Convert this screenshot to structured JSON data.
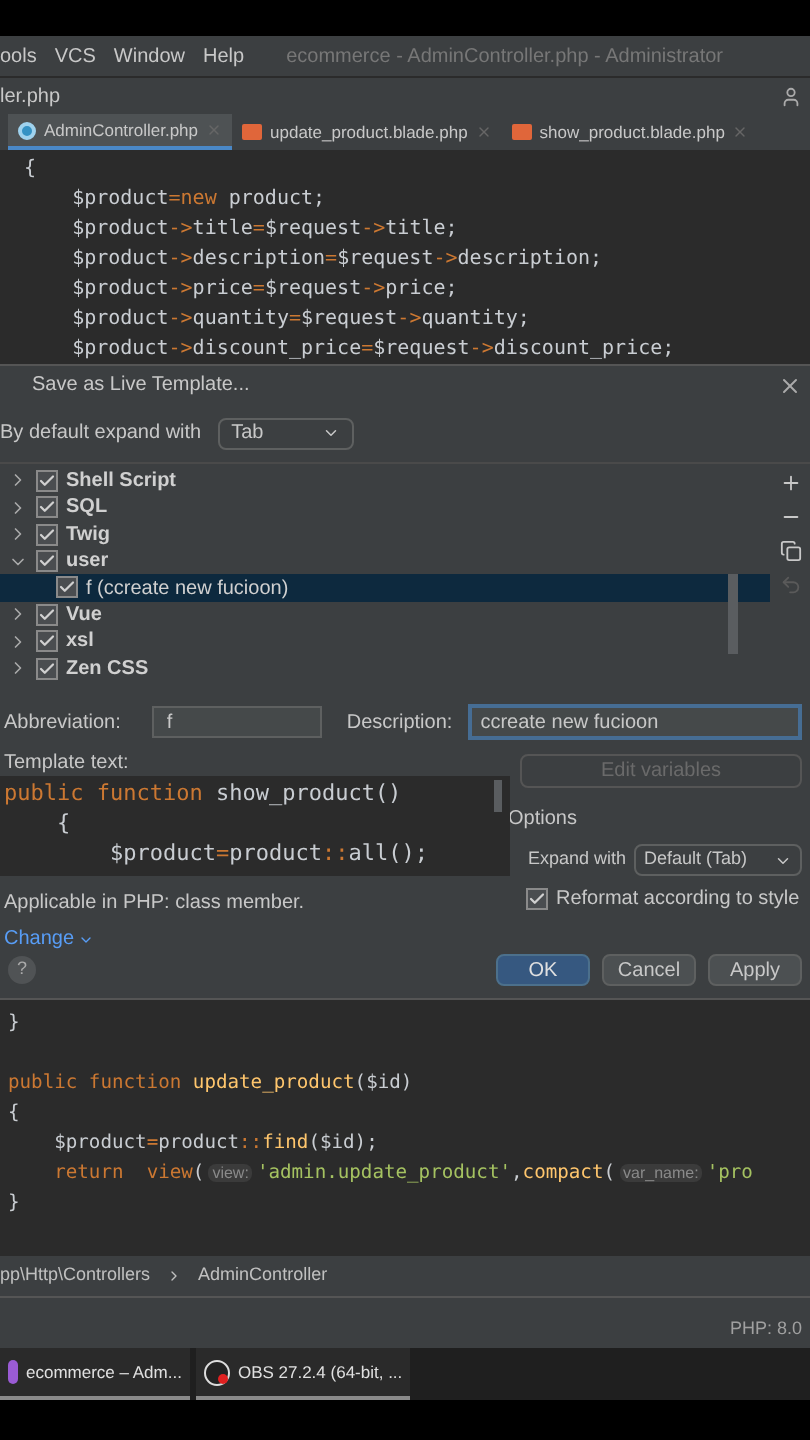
{
  "menu_bar": {
    "items": [
      "ools",
      "VCS",
      "Window",
      "Help"
    ],
    "title": "ecommerce - AdminController.php - Administrator"
  },
  "nav_bar": {
    "path": "ler.php"
  },
  "tabs": [
    {
      "label": "AdminController.php",
      "kind": "php",
      "selected": true
    },
    {
      "label": "update_product.blade.php",
      "kind": "blade",
      "selected": false
    },
    {
      "label": "show_product.blade.php",
      "kind": "blade",
      "selected": false
    }
  ],
  "editor_top": [
    [
      {
        "kind": "plain",
        "text": "{"
      }
    ],
    [
      {
        "kind": "plain",
        "text": "    $product"
      },
      {
        "kind": "op",
        "text": "="
      },
      {
        "kind": "kw",
        "text": "new"
      },
      {
        "kind": "plain",
        "text": " product;"
      }
    ],
    [
      {
        "kind": "plain",
        "text": "    $product"
      },
      {
        "kind": "op",
        "text": "->"
      },
      {
        "kind": "plain",
        "text": "title"
      },
      {
        "kind": "op",
        "text": "="
      },
      {
        "kind": "plain",
        "text": "$request"
      },
      {
        "kind": "op",
        "text": "->"
      },
      {
        "kind": "plain",
        "text": "title;"
      }
    ],
    [
      {
        "kind": "plain",
        "text": "    $product"
      },
      {
        "kind": "op",
        "text": "->"
      },
      {
        "kind": "plain",
        "text": "description"
      },
      {
        "kind": "op",
        "text": "="
      },
      {
        "kind": "plain",
        "text": "$request"
      },
      {
        "kind": "op",
        "text": "->"
      },
      {
        "kind": "plain",
        "text": "description;"
      }
    ],
    [
      {
        "kind": "plain",
        "text": "    $product"
      },
      {
        "kind": "op",
        "text": "->"
      },
      {
        "kind": "plain",
        "text": "price"
      },
      {
        "kind": "op",
        "text": "="
      },
      {
        "kind": "plain",
        "text": "$request"
      },
      {
        "kind": "op",
        "text": "->"
      },
      {
        "kind": "plain",
        "text": "price;"
      }
    ],
    [
      {
        "kind": "plain",
        "text": "    $product"
      },
      {
        "kind": "op",
        "text": "->"
      },
      {
        "kind": "plain",
        "text": "quantity"
      },
      {
        "kind": "op",
        "text": "="
      },
      {
        "kind": "plain",
        "text": "$request"
      },
      {
        "kind": "op",
        "text": "->"
      },
      {
        "kind": "plain",
        "text": "quantity;"
      }
    ],
    [
      {
        "kind": "plain",
        "text": "    $product"
      },
      {
        "kind": "op",
        "text": "->"
      },
      {
        "kind": "plain",
        "text": "discount_price"
      },
      {
        "kind": "op",
        "text": "="
      },
      {
        "kind": "plain",
        "text": "$request"
      },
      {
        "kind": "op",
        "text": "->"
      },
      {
        "kind": "plain",
        "text": "discount_price;"
      }
    ]
  ],
  "dialog": {
    "title": "Save as Live Template...",
    "expand_label": "By default expand with",
    "expand_value": "Tab",
    "tree": [
      {
        "label": "Shell Script",
        "expanded": false,
        "checked": true,
        "selected": false
      },
      {
        "label": "SQL",
        "expanded": false,
        "checked": true,
        "selected": false
      },
      {
        "label": "Twig",
        "expanded": false,
        "checked": true,
        "selected": false
      },
      {
        "label": "user",
        "expanded": true,
        "checked": true,
        "selected": false,
        "children": [
          {
            "label": "f (ccreate new fucioon)",
            "checked": true,
            "selected": true
          }
        ]
      },
      {
        "label": "Vue",
        "expanded": false,
        "checked": true,
        "selected": false
      },
      {
        "label": "xsl",
        "expanded": false,
        "checked": true,
        "selected": false
      },
      {
        "label": "Zen CSS",
        "expanded": false,
        "checked": true,
        "selected": false
      }
    ],
    "toolbar": [
      {
        "kind": "add",
        "disabled": false
      },
      {
        "kind": "remove",
        "disabled": false
      },
      {
        "kind": "copy",
        "disabled": false
      },
      {
        "kind": "undo",
        "disabled": true
      }
    ],
    "abbreviation_label": "Abbreviation:",
    "abbreviation": "f",
    "description_label": "Description:",
    "description": "ccreate new fucioon",
    "template_label": "Template text:",
    "template": [
      [
        {
          "kind": "kw",
          "text": "public function "
        },
        {
          "kind": "plain",
          "text": "show_product()"
        }
      ],
      [
        {
          "kind": "plain",
          "text": "    {"
        }
      ],
      [
        {
          "kind": "plain",
          "text": "        $product"
        },
        {
          "kind": "op",
          "text": "="
        },
        {
          "kind": "plain",
          "text": "product"
        },
        {
          "kind": "op",
          "text": "::"
        },
        {
          "kind": "plain",
          "text": "all();"
        }
      ]
    ],
    "edit_variables": {
      "label": "Edit variables",
      "disabled": true
    },
    "options_label": "Options",
    "expand_with_label": "Expand with",
    "expand_with_value": "Default (Tab)",
    "reformat": {
      "label": "Reformat according to style",
      "checked": true
    },
    "applicable": "Applicable in PHP: class member.",
    "change_link": "Change",
    "help": "?",
    "buttons": [
      {
        "label": "OK",
        "kind": "primary"
      },
      {
        "label": "Cancel",
        "kind": "default"
      },
      {
        "label": "Apply",
        "kind": "default"
      }
    ]
  },
  "editor_bottom": [
    [
      {
        "kind": "plain",
        "text": "}"
      }
    ],
    [
      {
        "kind": "kw",
        "text": "public function "
      },
      {
        "kind": "fn",
        "text": "update_product"
      },
      {
        "kind": "plain",
        "text": "($id)"
      }
    ],
    [
      {
        "kind": "plain",
        "text": "{"
      }
    ],
    [
      {
        "kind": "plain",
        "text": "    $product"
      },
      {
        "kind": "op",
        "text": "="
      },
      {
        "kind": "plain",
        "text": "product"
      },
      {
        "kind": "op",
        "text": "::"
      },
      {
        "kind": "fn",
        "text": "find"
      },
      {
        "kind": "plain",
        "text": "($id);"
      }
    ],
    [
      {
        "kind": "kw",
        "text": "    return  "
      },
      {
        "kind": "kw",
        "text": "view"
      },
      {
        "kind": "plain",
        "text": "("
      },
      {
        "kind": "hint",
        "text": "view:"
      },
      {
        "kind": "str",
        "text": "'admin.update_product'"
      },
      {
        "kind": "plain",
        "text": ","
      },
      {
        "kind": "fn",
        "text": "compact"
      },
      {
        "kind": "plain",
        "text": "("
      },
      {
        "kind": "hint",
        "text": "var_name:"
      },
      {
        "kind": "str",
        "text": "'pro"
      }
    ],
    [
      {
        "kind": "plain",
        "text": "}"
      }
    ]
  ],
  "breadcrumb": [
    "pp\\Http\\Controllers",
    "AdminController"
  ],
  "status_bar": {
    "php": "PHP: 8.0"
  },
  "taskbar": [
    {
      "label": "ecommerce – Adm...",
      "kind": "ide"
    },
    {
      "label": "OBS 27.2.4 (64-bit, ...",
      "kind": "obs"
    }
  ]
}
